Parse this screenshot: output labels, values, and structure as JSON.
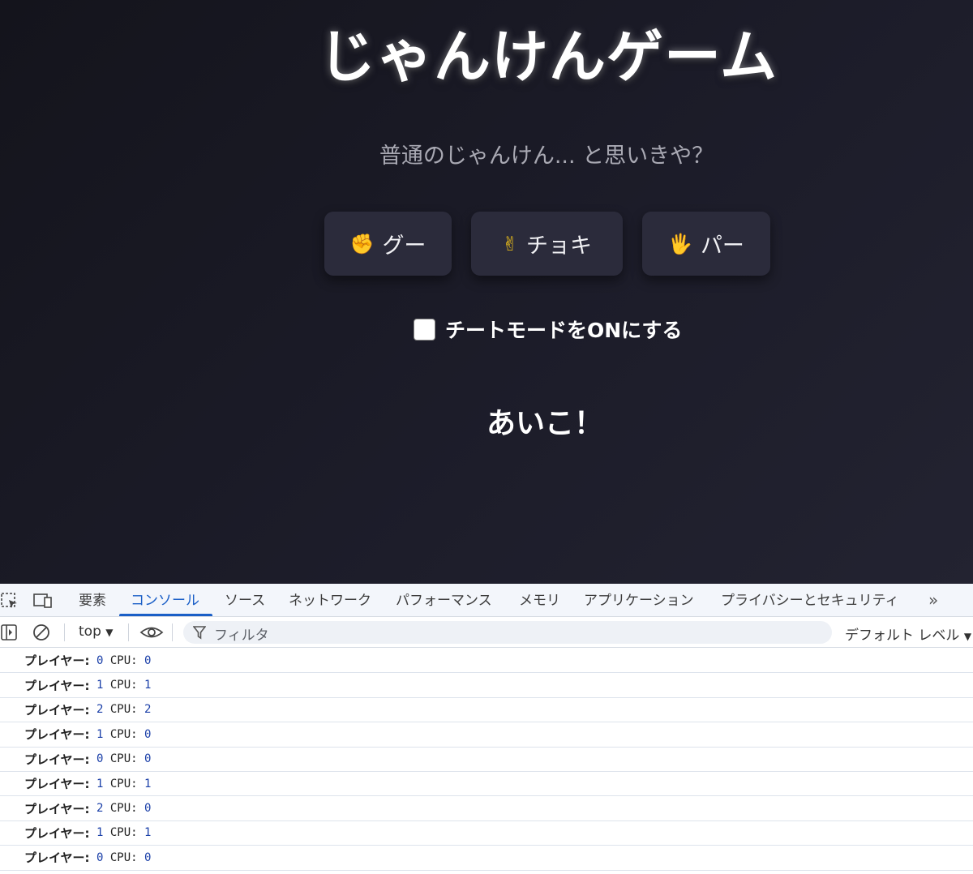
{
  "game": {
    "title": "じゃんけんゲーム",
    "subtitle": "普通のじゃんけん... と思いきや？",
    "buttons": [
      {
        "emoji": "✊",
        "label": "グー",
        "icon": "fist-icon"
      },
      {
        "emoji": "✌",
        "label": "チョキ",
        "icon": "victory-hand-icon"
      },
      {
        "emoji": "🖐",
        "label": "パー",
        "icon": "open-hand-icon"
      }
    ],
    "cheat_label": "チートモードをONにする",
    "cheat_checked": false,
    "result": "あいこ！"
  },
  "devtools": {
    "tabs": [
      "要素",
      "コンソール",
      "ソース",
      "ネットワーク",
      "パフォーマンス",
      "メモリ",
      "アプリケーション",
      "プライバシーとセキュリティ"
    ],
    "active_tab": "コンソール",
    "context": "top",
    "filter_placeholder": "フィルタ",
    "level": "デフォルト レベル",
    "log_label_player": "プレイヤー:",
    "log_label_cpu": "CPU:",
    "logs": [
      {
        "player": 0,
        "cpu": 0
      },
      {
        "player": 1,
        "cpu": 1
      },
      {
        "player": 2,
        "cpu": 2
      },
      {
        "player": 1,
        "cpu": 0
      },
      {
        "player": 0,
        "cpu": 0
      },
      {
        "player": 1,
        "cpu": 1
      },
      {
        "player": 2,
        "cpu": 0
      },
      {
        "player": 1,
        "cpu": 1
      },
      {
        "player": 0,
        "cpu": 0
      }
    ]
  }
}
